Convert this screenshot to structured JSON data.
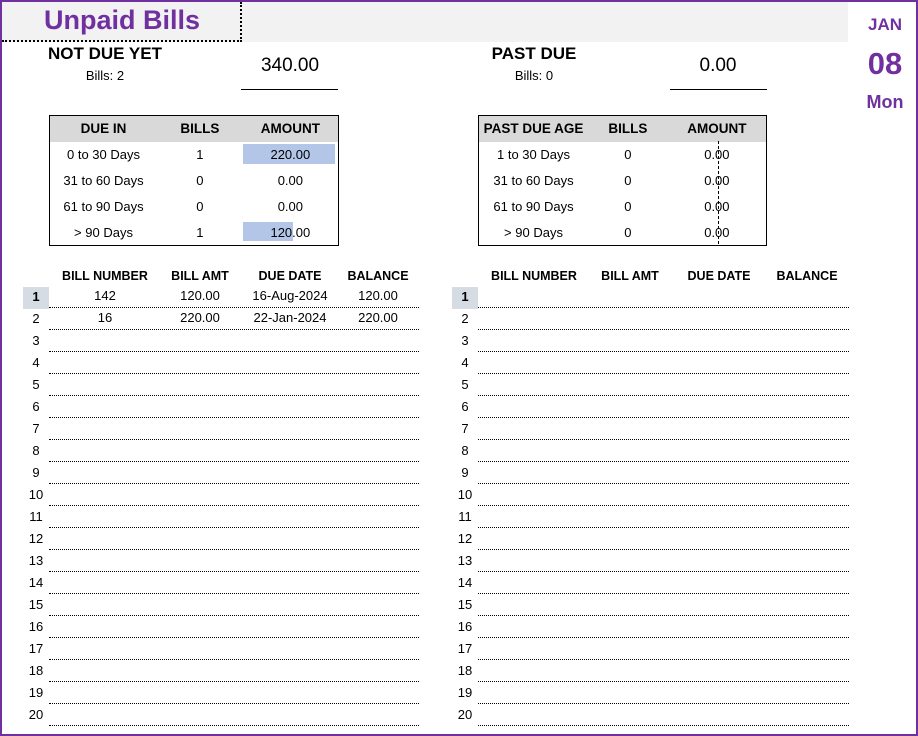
{
  "title": "Unpaid Bills",
  "date": {
    "month": "JAN",
    "day": "08",
    "weekday": "Mon"
  },
  "not_due": {
    "title": "NOT DUE YET",
    "bills_label": "Bills: 2",
    "total": "340.00",
    "table": {
      "headers": [
        "DUE IN",
        "BILLS",
        "AMOUNT"
      ],
      "rows": [
        {
          "range": "0 to 30 Days",
          "bills": "1",
          "amount": "220.00",
          "bar_fraction": 1.0
        },
        {
          "range": "31 to 60 Days",
          "bills": "0",
          "amount": "0.00",
          "bar_fraction": 0
        },
        {
          "range": "61 to 90 Days",
          "bills": "0",
          "amount": "0.00",
          "bar_fraction": 0
        },
        {
          "range": "> 90 Days",
          "bills": "1",
          "amount": "120.00",
          "bar_fraction": 0.545
        }
      ]
    }
  },
  "past_due": {
    "title": "PAST DUE",
    "bills_label": "Bills: 0",
    "total": "0.00",
    "table": {
      "headers": [
        "PAST DUE AGE",
        "BILLS",
        "AMOUNT"
      ],
      "rows": [
        {
          "range": "1 to 30 Days",
          "bills": "0",
          "amount": "0.00"
        },
        {
          "range": "31 to 60 Days",
          "bills": "0",
          "amount": "0.00"
        },
        {
          "range": "61 to 90 Days",
          "bills": "0",
          "amount": "0.00"
        },
        {
          "range": "> 90 Days",
          "bills": "0",
          "amount": "0.00"
        }
      ]
    }
  },
  "list_headers": [
    "BILL NUMBER",
    "BILL AMT",
    "DUE DATE",
    "BALANCE"
  ],
  "left_list": [
    {
      "n": "1",
      "bill_number": "142",
      "bill_amt": "120.00",
      "due_date": "16-Aug-2024",
      "balance": "120.00"
    },
    {
      "n": "2",
      "bill_number": "16",
      "bill_amt": "220.00",
      "due_date": "22-Jan-2024",
      "balance": "220.00"
    },
    {
      "n": "3"
    },
    {
      "n": "4"
    },
    {
      "n": "5"
    },
    {
      "n": "6"
    },
    {
      "n": "7"
    },
    {
      "n": "8"
    },
    {
      "n": "9"
    },
    {
      "n": "10"
    },
    {
      "n": "11"
    },
    {
      "n": "12"
    },
    {
      "n": "13"
    },
    {
      "n": "14"
    },
    {
      "n": "15"
    },
    {
      "n": "16"
    },
    {
      "n": "17"
    },
    {
      "n": "18"
    },
    {
      "n": "19"
    },
    {
      "n": "20"
    }
  ],
  "right_list": [
    {
      "n": "1"
    },
    {
      "n": "2"
    },
    {
      "n": "3"
    },
    {
      "n": "4"
    },
    {
      "n": "5"
    },
    {
      "n": "6"
    },
    {
      "n": "7"
    },
    {
      "n": "8"
    },
    {
      "n": "9"
    },
    {
      "n": "10"
    },
    {
      "n": "11"
    },
    {
      "n": "12"
    },
    {
      "n": "13"
    },
    {
      "n": "14"
    },
    {
      "n": "15"
    },
    {
      "n": "16"
    },
    {
      "n": "17"
    },
    {
      "n": "18"
    },
    {
      "n": "19"
    },
    {
      "n": "20"
    }
  ],
  "colors": {
    "accent": "#7030a0",
    "bar": "#b4c6e7",
    "header_bg": "#d9d9d9",
    "band_bg": "#f2f2f2"
  }
}
